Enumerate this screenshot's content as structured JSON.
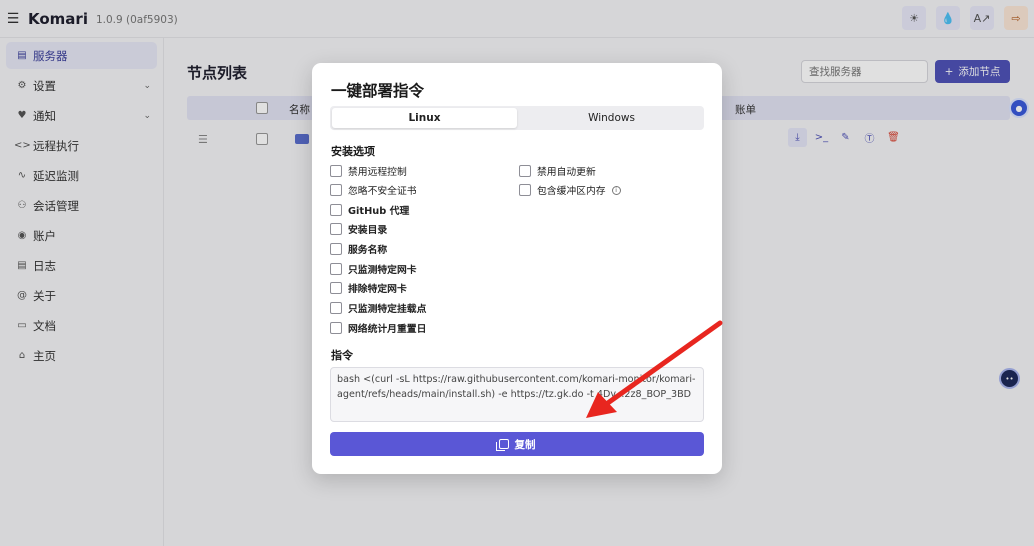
{
  "topbar": {
    "brand": "Komari",
    "version": "1.0.9 (0af5903)",
    "icons": [
      "sun-icon",
      "droplet-icon",
      "translate-icon",
      "logout-icon"
    ]
  },
  "sidebar": {
    "items": [
      {
        "label": "服务器",
        "icon": "server-icon",
        "active": true
      },
      {
        "label": "设置",
        "icon": "gear-icon",
        "expandable": true
      },
      {
        "label": "通知",
        "icon": "bell-icon",
        "expandable": true
      },
      {
        "label": "远程执行",
        "icon": "code-icon"
      },
      {
        "label": "延迟监测",
        "icon": "activity-icon"
      },
      {
        "label": "会话管理",
        "icon": "users-icon"
      },
      {
        "label": "账户",
        "icon": "user-circle-icon"
      },
      {
        "label": "日志",
        "icon": "file-icon"
      },
      {
        "label": "关于",
        "icon": "at-icon"
      },
      {
        "label": "文档",
        "icon": "book-icon"
      },
      {
        "label": "主页",
        "icon": "home-icon"
      }
    ]
  },
  "main": {
    "title": "节点列表",
    "search_placeholder": "查找服务器",
    "add_label": "添加节点",
    "table": {
      "columns": {
        "name": "名称",
        "billing": "账单"
      }
    }
  },
  "modal": {
    "title": "一键部署指令",
    "tabs": [
      {
        "label": "Linux",
        "active": true
      },
      {
        "label": "Windows",
        "active": false
      }
    ],
    "options_heading": "安装选项",
    "options_left": [
      "禁用远程控制",
      "忽略不安全证书",
      "GitHub 代理",
      "安装目录",
      "服务名称",
      "只监测特定网卡",
      "排除特定网卡",
      "只监测特定挂载点",
      "网络统计月重置日"
    ],
    "options_right": [
      "禁用自动更新",
      "包含缓冲区内存"
    ],
    "command_heading": "指令",
    "command": "bash <(curl -sL https://raw.githubusercontent.com/komari-monitor/komari-agent/refs/heads/main/install.sh) -e https://tz.gk.do -t 4Dv...2z8_BOP_3BD",
    "copy_label": "复制"
  },
  "colors": {
    "accent": "#4f52b8",
    "copy_button": "#5a57d6",
    "annotation_arrow": "#e8261f"
  }
}
